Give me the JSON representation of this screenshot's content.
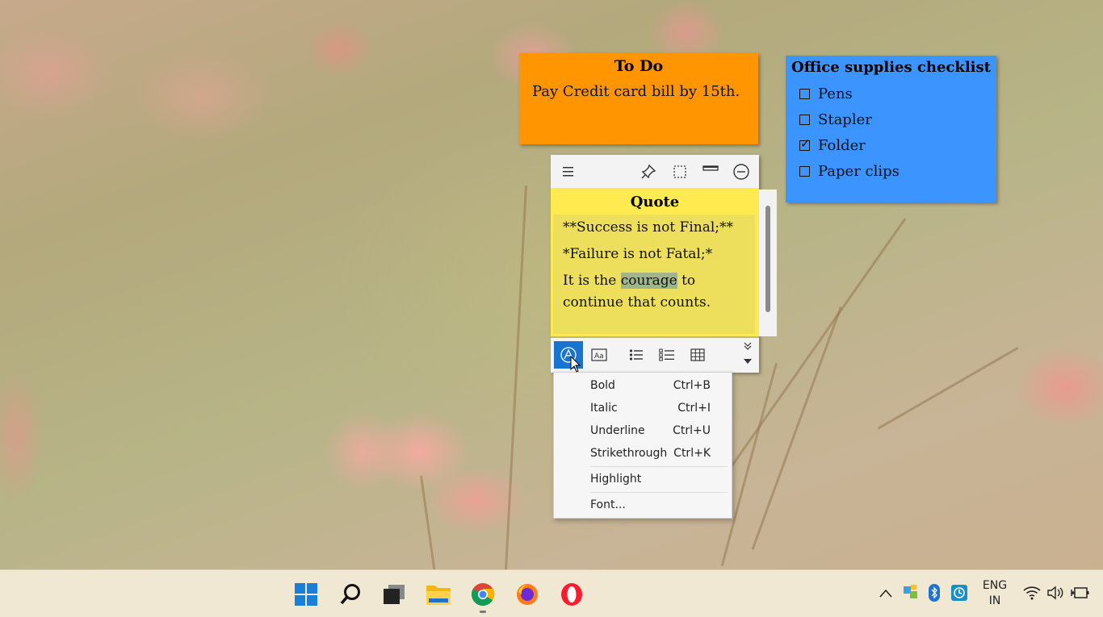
{
  "notes": {
    "todo": {
      "title": "To Do",
      "body": "Pay Credit card bill by 15th.",
      "color": "#ff9500"
    },
    "office": {
      "title": "Office supplies checklist",
      "color": "#3c94ff",
      "items": [
        {
          "label": "Pens",
          "checked": false
        },
        {
          "label": "Stapler",
          "checked": false
        },
        {
          "label": "Folder",
          "checked": true
        },
        {
          "label": "Paper clips",
          "checked": false
        }
      ]
    },
    "quote": {
      "title": "Quote",
      "color": "#ffeb4f",
      "line1": "**Success is not Final;**",
      "line2": "*Failure is not Fatal;*",
      "line3_pre": "It is the ",
      "line3_highlight": "courage",
      "line3_post": " to",
      "line4": "continue that counts."
    }
  },
  "quote_toolbar": {
    "icons": [
      "menu-icon",
      "pin-icon",
      "select-icon",
      "collapse-icon",
      "minimize-icon"
    ]
  },
  "format_bar": {
    "buttons": [
      "text-format-icon",
      "font-size-icon",
      "bullet-list-icon",
      "checklist-icon",
      "table-icon"
    ],
    "expand": "chevron-double-down-icon"
  },
  "format_menu": {
    "items": [
      {
        "label": "Bold",
        "shortcut": "Ctrl+B"
      },
      {
        "label": "Italic",
        "shortcut": "Ctrl+I"
      },
      {
        "label": "Underline",
        "shortcut": "Ctrl+U"
      },
      {
        "label": "Strikethrough",
        "shortcut": "Ctrl+K"
      },
      {
        "label": "Highlight",
        "shortcut": ""
      },
      {
        "label": "Font...",
        "shortcut": ""
      }
    ]
  },
  "taskbar": {
    "apps": [
      "windows-start-icon",
      "search-icon",
      "task-view-icon",
      "file-explorer-icon",
      "chrome-icon",
      "firefox-icon",
      "opera-icon"
    ],
    "tray": {
      "lang_line1": "ENG",
      "lang_line2": "IN"
    }
  }
}
